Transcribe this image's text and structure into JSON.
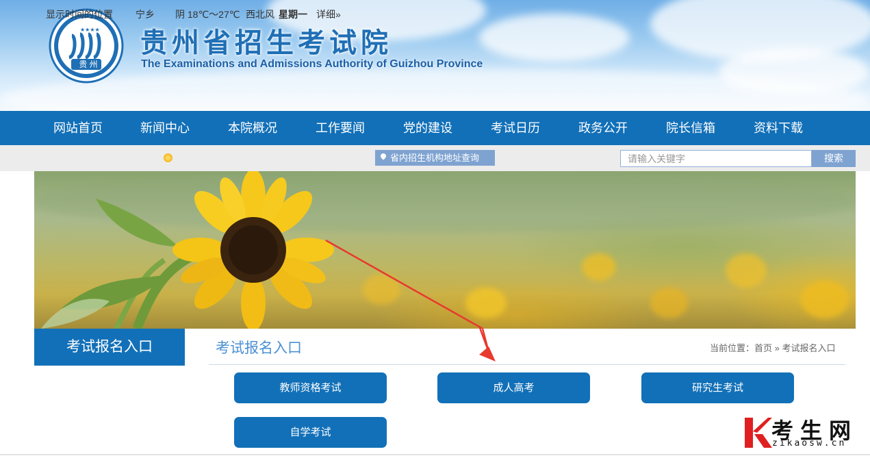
{
  "header": {
    "title": "贵州省招生考试院",
    "subtitle": "The Examinations and Admissions Authority of Guizhou Province",
    "logo_text": "贵 州"
  },
  "nav": {
    "items": [
      {
        "label": "网站首页"
      },
      {
        "label": "新闻中心"
      },
      {
        "label": "本院概况"
      },
      {
        "label": "工作要闻"
      },
      {
        "label": "党的建设"
      },
      {
        "label": "考试日历"
      },
      {
        "label": "政务公开"
      },
      {
        "label": "院长信箱"
      },
      {
        "label": "资料下载"
      }
    ]
  },
  "infobar": {
    "location_label": "显示时间的位置",
    "city": "宁乡",
    "weather": "阴 18℃～27℃",
    "wind": "西北风",
    "weekday": "星期一",
    "detail_link": "详细»",
    "address_query": "省内招生机构地址查询",
    "search_placeholder": "请输入关键字",
    "search_button": "搜索"
  },
  "content": {
    "side_title": "考试报名入口",
    "main_title": "考试报名入口",
    "breadcrumb": "当前位置：首页 » 考试报名入口",
    "entries": [
      {
        "label": "教师资格考试"
      },
      {
        "label": "成人高考"
      },
      {
        "label": "研究生考试"
      },
      {
        "label": "自学考试"
      }
    ]
  },
  "watermark": {
    "text": "考生网",
    "url": "zikaosw.cn"
  },
  "colors": {
    "primary": "#1270b8",
    "accent_light": "#7fa3d1",
    "annotation_arrow": "#e8392f"
  }
}
